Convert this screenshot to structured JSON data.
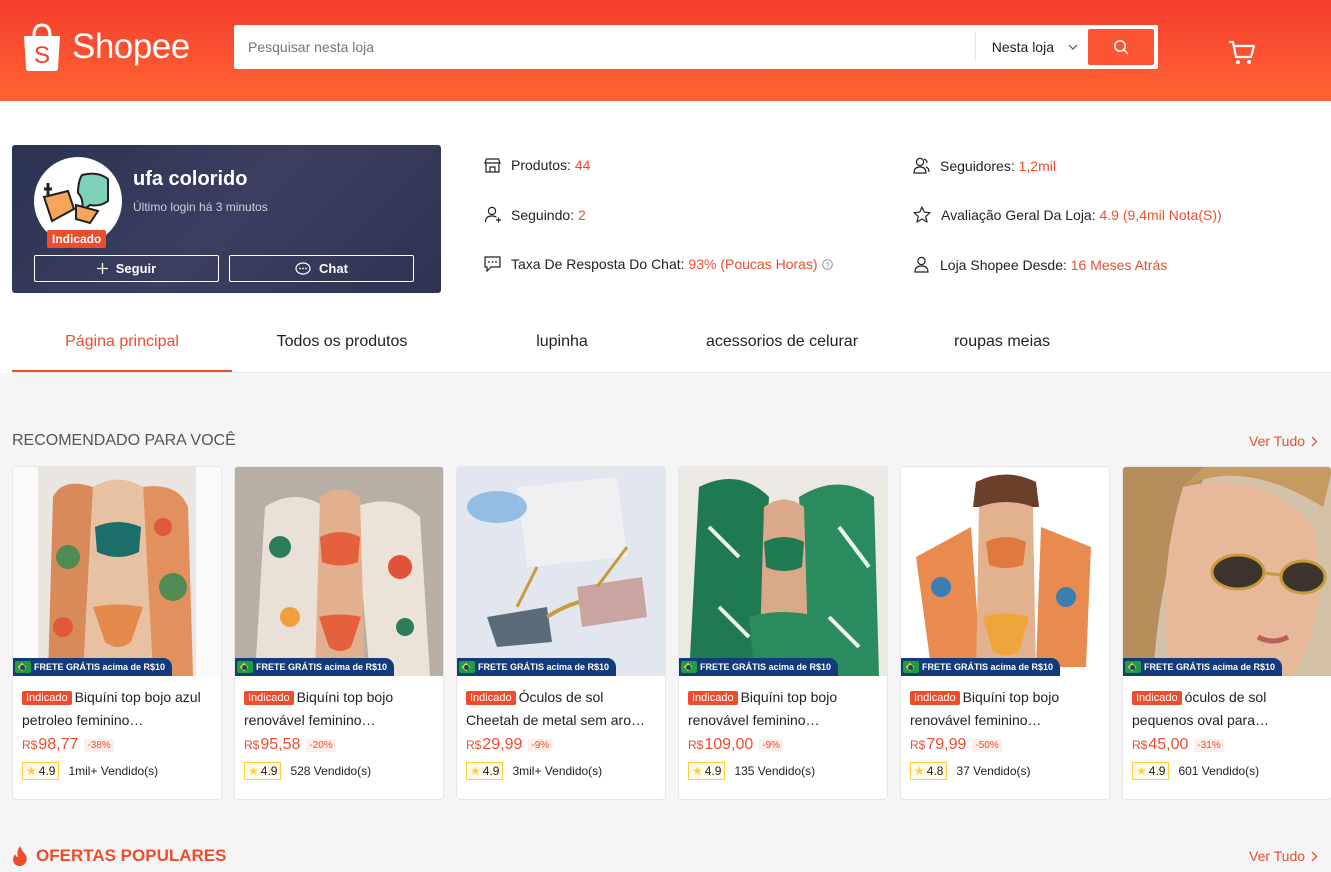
{
  "header": {
    "brand": "Shopee",
    "search_placeholder": "Pesquisar nesta loja",
    "search_scope": "Nesta loja"
  },
  "shop": {
    "name": "ufa colorido",
    "last_login": "Último login há 3 minutos",
    "badge": "Indicado",
    "follow_label": "Seguir",
    "chat_label": "Chat",
    "stats": {
      "produtos_label": "Produtos: ",
      "produtos_value": "44",
      "seguindo_label": "Seguindo: ",
      "seguindo_value": "2",
      "chat_rate_label": "Taxa De Resposta Do Chat: ",
      "chat_rate_value": "93% (Poucas Horas)",
      "seguidores_label": "Seguidores: ",
      "seguidores_value": "1,2mil",
      "avaliacao_label": "Avaliação Geral Da Loja: ",
      "avaliacao_value": "4.9 (9,4mil Nota(S))",
      "desde_label": "Loja Shopee Desde: ",
      "desde_value": "16 Meses Atrás"
    }
  },
  "tabs": [
    {
      "label": "Página principal"
    },
    {
      "label": "Todos os produtos"
    },
    {
      "label": "lupinha"
    },
    {
      "label": "acessorios de celurar"
    },
    {
      "label": "roupas meias"
    }
  ],
  "recommended": {
    "title": "RECOMENDADO PARA VOCÊ",
    "see_all": "Ver Tudo",
    "frete_label": "FRETE GRÁTIS acima de R$10",
    "tag_label": "Indicado",
    "products": [
      {
        "name": "Biquíni top bojo azul petroleo feminino…",
        "currency": "R$",
        "price": "98,77",
        "discount": "-38%",
        "rating": "4.9",
        "sold": "1mil+ Vendido(s)"
      },
      {
        "name": "Biquíni top bojo renovável feminino…",
        "currency": "R$",
        "price": "95,58",
        "discount": "-20%",
        "rating": "4.9",
        "sold": "528 Vendido(s)"
      },
      {
        "name": "Óculos de sol Cheetah de metal sem aro…",
        "currency": "R$",
        "price": "29,99",
        "discount": "-9%",
        "rating": "4.9",
        "sold": "3mil+ Vendido(s)"
      },
      {
        "name": "Biquíni top bojo renovável feminino…",
        "currency": "R$",
        "price": "109,00",
        "discount": "-9%",
        "rating": "4.9",
        "sold": "135 Vendido(s)"
      },
      {
        "name": "Biquíni top bojo renovável feminino…",
        "currency": "R$",
        "price": "79,99",
        "discount": "-50%",
        "rating": "4.8",
        "sold": "37 Vendido(s)"
      },
      {
        "name": "óculos de sol pequenos oval para…",
        "currency": "R$",
        "price": "45,00",
        "discount": "-31%",
        "rating": "4.9",
        "sold": "601 Vendido(s)"
      }
    ]
  },
  "ofertas": {
    "title": "OFERTAS POPULARES",
    "see_all": "Ver Tudo"
  },
  "colors": {
    "brand": "#ee4d2d",
    "header_gradient_top": "#f53d2d",
    "header_gradient_bottom": "#fe6433",
    "shop_card": "#2f3350"
  }
}
